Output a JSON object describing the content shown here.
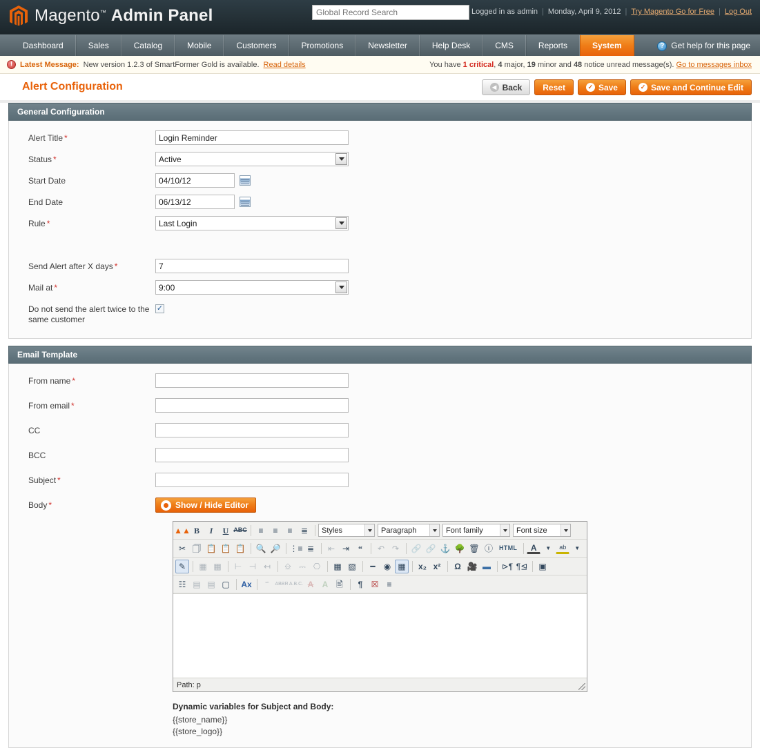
{
  "header": {
    "brand": "Magento",
    "brand_tm": "™",
    "brand_suffix": "Admin Panel",
    "logo_icon": "magento-logo-icon",
    "search_placeholder": "Global Record Search",
    "search_value": "",
    "logged_in_as": "Logged in as admin",
    "date": "Monday, April 9, 2012",
    "try_link": "Try Magento Go for Free",
    "logout_link": "Log Out",
    "sep": "|"
  },
  "nav": {
    "items": [
      {
        "label": "Dashboard",
        "active": false
      },
      {
        "label": "Sales",
        "active": false
      },
      {
        "label": "Catalog",
        "active": false
      },
      {
        "label": "Mobile",
        "active": false
      },
      {
        "label": "Customers",
        "active": false
      },
      {
        "label": "Promotions",
        "active": false
      },
      {
        "label": "Newsletter",
        "active": false
      },
      {
        "label": "Help Desk",
        "active": false
      },
      {
        "label": "CMS",
        "active": false
      },
      {
        "label": "Reports",
        "active": false
      },
      {
        "label": "System",
        "active": true
      }
    ],
    "help_label": "Get help for this page",
    "help_icon": "question-mark-icon"
  },
  "message_bar": {
    "icon": "error-circle-icon",
    "label": "Latest Message:",
    "text": "New version 1.2.3 of SmartFormer Gold is available.",
    "read_details": "Read details",
    "counts_prefix": "You have",
    "critical_count": "1",
    "critical_word": "critical",
    "major_count": "4",
    "major_word": "major,",
    "minor_count": "19",
    "minor_word": "minor and",
    "notice_count": "48",
    "notice_word": "notice unread message(s).",
    "inbox_link": "Go to messages inbox"
  },
  "page": {
    "title": "Alert Configuration",
    "buttons": [
      {
        "label": "Back",
        "style": "grey",
        "icon": "back-arrow-icon"
      },
      {
        "label": "Reset",
        "style": "orange",
        "icon": ""
      },
      {
        "label": "Save",
        "style": "orange",
        "icon": "check-circle-icon"
      },
      {
        "label": "Save and Continue Edit",
        "style": "orange",
        "icon": "check-circle-icon"
      }
    ]
  },
  "general_configuration": {
    "section_title": "General Configuration",
    "alert_title": {
      "label": "Alert Title",
      "required": true,
      "value": "Login Reminder"
    },
    "status": {
      "label": "Status",
      "required": true,
      "value": "Active"
    },
    "start_date": {
      "label": "Start Date",
      "required": false,
      "value": "04/10/12",
      "icon": "calendar-icon"
    },
    "end_date": {
      "label": "End Date",
      "required": false,
      "value": "06/13/12",
      "icon": "calendar-icon"
    },
    "rule": {
      "label": "Rule",
      "required": true,
      "value": "Last Login"
    },
    "send_after_days": {
      "label": "Send Alert after X days",
      "required": true,
      "value": "7"
    },
    "mail_at": {
      "label": "Mail at",
      "required": true,
      "value": "9:00"
    },
    "no_twice": {
      "label": "Do not send the alert twice to the same customer",
      "required": false,
      "checked": true
    }
  },
  "email_template": {
    "section_title": "Email Template",
    "from_name": {
      "label": "From name",
      "required": true,
      "value": ""
    },
    "from_email": {
      "label": "From email",
      "required": true,
      "value": ""
    },
    "cc": {
      "label": "CC",
      "required": false,
      "value": ""
    },
    "bcc": {
      "label": "BCC",
      "required": false,
      "value": ""
    },
    "subject": {
      "label": "Subject",
      "required": true,
      "value": ""
    },
    "body": {
      "label": "Body",
      "required": true
    },
    "show_hide_editor": {
      "label": "Show / Hide Editor",
      "icon": "eye-icon"
    }
  },
  "editor": {
    "selects": [
      {
        "name": "styles-select",
        "value": "Styles"
      },
      {
        "name": "paragraph-select",
        "value": "Paragraph"
      },
      {
        "name": "font-family-select",
        "value": "Font family"
      },
      {
        "name": "font-size-select",
        "value": "Font size"
      }
    ],
    "row1_icons": [
      "magento-widget-icon",
      "bold-icon",
      "italic-icon",
      "underline-icon",
      "strikethrough-icon",
      "align-left-icon",
      "align-center-icon",
      "align-right-icon",
      "align-justify-icon"
    ],
    "row2_icons": [
      "cut-icon",
      "copy-icon",
      "paste-icon",
      "paste-text-icon",
      "paste-word-icon",
      "find-icon",
      "find-replace-icon",
      "bullet-list-icon",
      "numbered-list-icon",
      "outdent-icon",
      "indent-icon",
      "blockquote-icon",
      "undo-icon",
      "redo-icon",
      "link-icon",
      "unlink-icon",
      "anchor-icon",
      "image-icon",
      "cleanup-icon",
      "help-icon",
      "html-icon",
      "forecolor-icon",
      "backcolor-icon"
    ],
    "row3_icons": [
      "edit-css-icon",
      "insert-row-before-icon",
      "insert-row-after-icon",
      "delete-row-icon",
      "insert-col-before-icon",
      "insert-col-after-icon",
      "delete-col-icon",
      "split-cell-icon",
      "merge-cell-icon",
      "table-icon",
      "table-props-icon",
      "hr-icon",
      "remove-format-icon",
      "visual-aid-icon",
      "subscript-icon",
      "superscript-icon",
      "charmap-icon",
      "media-icon",
      "page-break-icon",
      "ltr-icon",
      "rtl-icon",
      "fullscreen-icon"
    ],
    "row4_icons": [
      "select-all-icon",
      "insert-layer-icon",
      "move-layer-icon",
      "insert-div-icon",
      "style-props-icon",
      "citation-icon",
      "abbr-icon",
      "acronym-icon",
      "delete-text-icon",
      "insert-text-icon",
      "attributes-icon",
      "show-blocks-icon",
      "nonbreaking-icon",
      "pagebreak-icon"
    ],
    "html_label": "HTML",
    "status_path": "Path: p"
  },
  "dynamic_variables": {
    "title": "Dynamic variables for Subject and Body:",
    "items": [
      "{{store_name}}",
      "{{store_logo}}"
    ]
  },
  "colors": {
    "accent_orange": "#e8620a",
    "header_dark": "#243036",
    "nav_grey": "#5e6c73",
    "section_head": "#62757e",
    "required_red": "#d1332e",
    "link_orange": "#d8650c"
  }
}
